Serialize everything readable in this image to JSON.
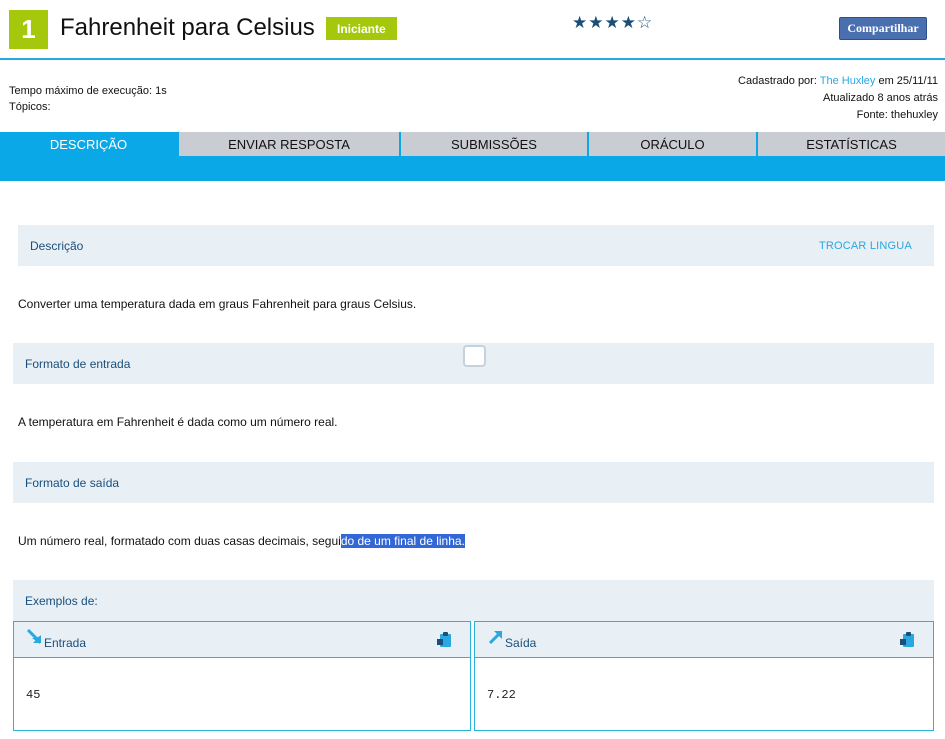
{
  "header": {
    "problem_number": "1",
    "title": "Fahrenheit para Celsius",
    "level": "Iniciante",
    "rating_stars": "★★★★☆",
    "share_label": "Compartilhar"
  },
  "meta": {
    "time_limit": "Tempo máximo de execução: 1s",
    "topics": "Tópicos:",
    "registered_prefix": "Cadastrado por:",
    "registered_by": "The Huxley",
    "registered_suffix": "em 25/11/11",
    "updated": "Atualizado 8 anos atrás",
    "source": "Fonte: thehuxley"
  },
  "tabs": [
    {
      "label": "DESCRIÇÃO"
    },
    {
      "label": "ENVIAR RESPOSTA"
    },
    {
      "label": "SUBMISSÕES"
    },
    {
      "label": "ORÁCULO"
    },
    {
      "label": "ESTATÍSTICAS"
    }
  ],
  "description": {
    "header": "Descrição",
    "change_language": "TROCAR LINGUA",
    "text": "Converter uma temperatura dada em graus Fahrenheit para graus Celsius."
  },
  "input_format": {
    "header": "Formato de entrada",
    "text": "A temperatura em Fahrenheit é dada como um número real."
  },
  "output_format": {
    "header": "Formato de saída",
    "text_plain": "Um número real, formatado com duas casas decimais, segui",
    "text_selected": "do de um final de linha."
  },
  "examples": {
    "header": "Exemplos de:",
    "input_label": "Entrada",
    "output_label": "Saída",
    "input_value": "45",
    "output_value": "7.22"
  },
  "colors": {
    "accent_blue": "#0aa8e6",
    "badge_green": "#a6c80c",
    "section_bg": "#e8eff5",
    "selection": "#3367d6"
  }
}
